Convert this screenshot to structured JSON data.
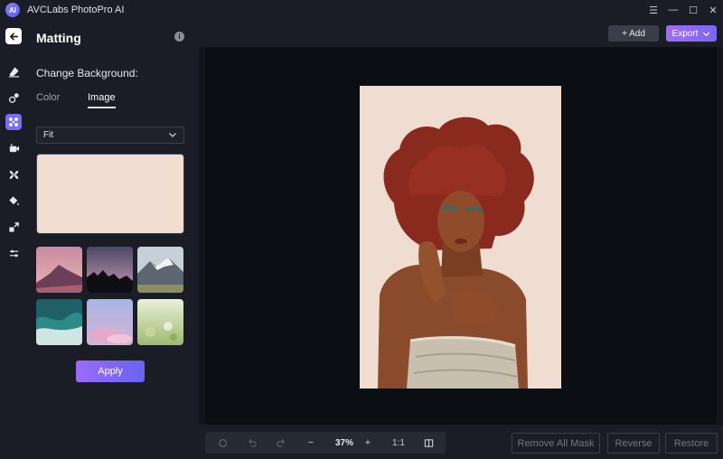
{
  "app": {
    "title": "AVCLabs PhotoPro AI",
    "logo_text": "AI"
  },
  "window_controls": {
    "menu": "☰",
    "minimize": "—",
    "maximize": "☐",
    "close": "✕"
  },
  "panel": {
    "title": "Matting",
    "section_label": "Change Background:",
    "tabs": {
      "color": "Color",
      "image": "Image"
    },
    "fit_select": {
      "value": "Fit"
    },
    "preview_color": "#f1ddd1",
    "apply_label": "Apply"
  },
  "topbar": {
    "add_label": "+ Add",
    "export_label": "Export"
  },
  "toolbar": {
    "zoom_out": "−",
    "zoom_level": "37%",
    "zoom_in": "+",
    "actual_size": "1:1"
  },
  "actions": {
    "remove_all_mask": "Remove All Mask",
    "reverse": "Reverse",
    "restore": "Restore"
  },
  "colors": {
    "accent": "#7a6cf5",
    "panel_bg": "#1a1d25",
    "canvas_bg": "#0b0e13"
  }
}
